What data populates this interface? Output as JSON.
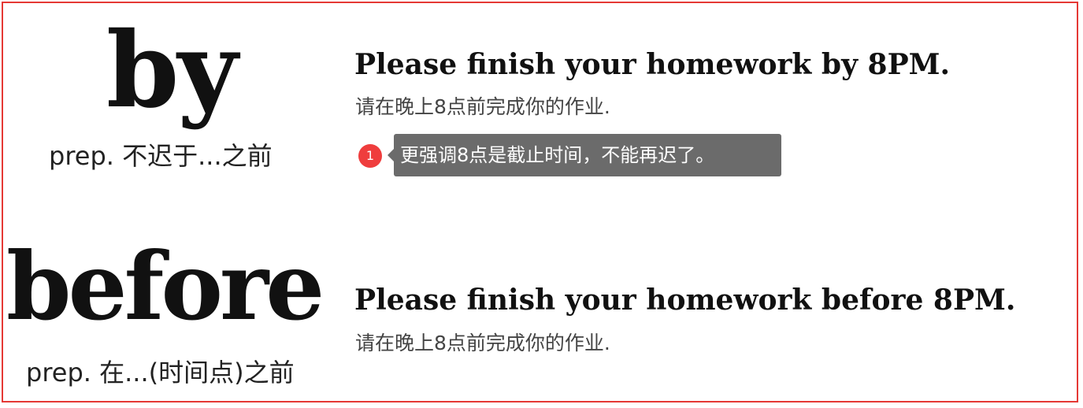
{
  "entries": [
    {
      "word": "by",
      "definition": "prep. 不迟于...之前",
      "example": "Please finish your homework by 8PM.",
      "translation": "请在晚上8点前完成你的作业.",
      "note": {
        "number": "1",
        "text": "更强调8点是截止时间，不能再迟了。"
      }
    },
    {
      "word": "before",
      "definition": "prep. 在...(时间点)之前",
      "example": "Please finish your homework before 8PM.",
      "translation": "请在晚上8点前完成你的作业."
    }
  ],
  "colors": {
    "frame_border": "#e53935",
    "note_marker": "#ef3d3d",
    "tooltip_background": "#6b6b6b"
  }
}
